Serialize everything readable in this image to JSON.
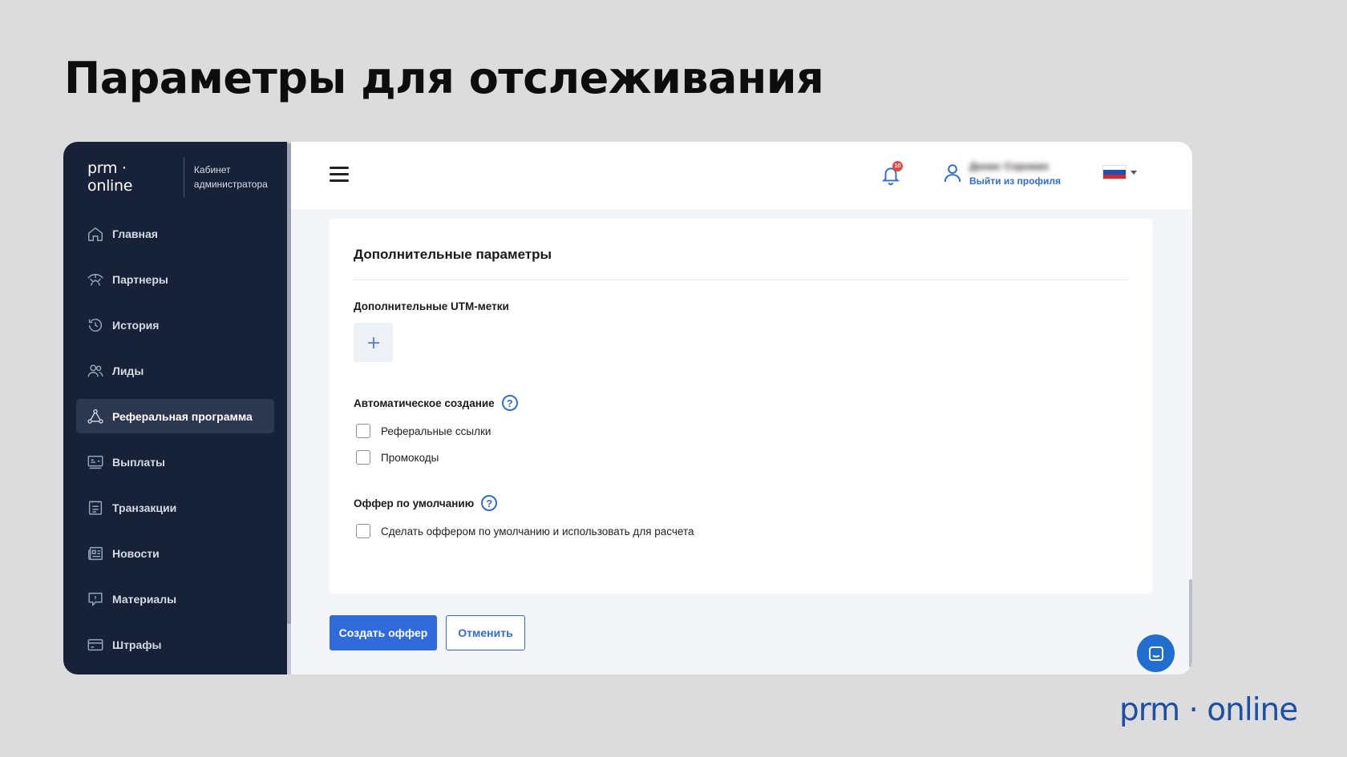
{
  "slide": {
    "title": "Параметры для отслеживания",
    "footer_brand": "prm · online"
  },
  "sidebar": {
    "brand": "prm · online",
    "cabinet": "Кабинет администратора",
    "items": [
      {
        "label": "Главная",
        "icon": "home-icon"
      },
      {
        "label": "Партнеры",
        "icon": "handshake-icon"
      },
      {
        "label": "История",
        "icon": "history-icon"
      },
      {
        "label": "Лиды",
        "icon": "users-icon"
      },
      {
        "label": "Реферальная программа",
        "icon": "referral-icon",
        "active": true
      },
      {
        "label": "Выплаты",
        "icon": "payout-icon"
      },
      {
        "label": "Транзакции",
        "icon": "transactions-icon"
      },
      {
        "label": "Новости",
        "icon": "news-icon"
      },
      {
        "label": "Материалы",
        "icon": "materials-icon"
      },
      {
        "label": "Штрафы",
        "icon": "card-icon"
      }
    ]
  },
  "header": {
    "notifications_count": "10",
    "user_name": "Денис Сорокин",
    "logout": "Выйти из профиля",
    "language": "ru"
  },
  "card": {
    "title": "Дополнительные параметры",
    "utm_label": "Дополнительные UTM-метки",
    "auto_label": "Автоматическое создание",
    "auto_options": [
      "Реферальные ссылки",
      "Промокоды"
    ],
    "offer_label": "Оффер по умолчанию",
    "offer_option": "Сделать оффером по умолчанию и использовать для расчета",
    "help_glyph": "?"
  },
  "actions": {
    "create": "Создать оффер",
    "cancel": "Отменить"
  },
  "colors": {
    "accent": "#2f6bdb",
    "sidebar_bg": "#172238",
    "badge": "#e9483f"
  }
}
